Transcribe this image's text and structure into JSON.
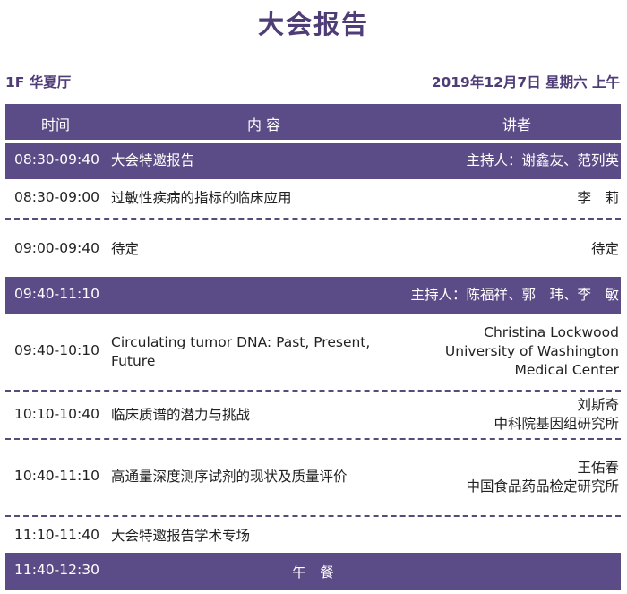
{
  "title": "大会报告",
  "venue": "1F 华夏厅",
  "date": "2019年12月7日 星期六 上午",
  "headers": {
    "time": "时间",
    "content": "内 容",
    "speaker": "讲者"
  },
  "rows": [
    {
      "time": "08:30-09:40",
      "content": "大会特邀报告",
      "speaker": "主持人：谢鑫友、范列英"
    },
    {
      "time": "08:30-09:00",
      "content": "过敏性疾病的指标的临床应用",
      "speaker": "李　莉"
    },
    {
      "time": "09:00-09:40",
      "content": "待定",
      "speaker": "待定"
    },
    {
      "time": "09:40-11:10",
      "content": "",
      "speaker": "主持人：陈福祥、郭　玮、李　敏"
    },
    {
      "time": "09:40-10:10",
      "content_lines": [
        "Circulating tumor DNA: Past, Present,",
        "Future"
      ],
      "speaker_lines": [
        "Christina Lockwood",
        "University of Washington",
        "Medical Center"
      ]
    },
    {
      "time": "10:10-10:40",
      "content": "临床质谱的潜力与挑战",
      "speaker_lines": [
        "刘斯奇",
        "中科院基因组研究所"
      ]
    },
    {
      "time": "10:40-11:10",
      "content": "高通量深度测序试剂的现状及质量评价",
      "speaker_lines": [
        "王佑春",
        "中国食品药品检定研究所"
      ]
    },
    {
      "time": "11:10-11:40",
      "content": "大会特邀报告学术专场",
      "speaker": ""
    },
    {
      "time": "11:40-12:30",
      "content": "午　餐",
      "speaker": ""
    }
  ],
  "colors": {
    "accent": "#5b4b86",
    "title": "#4f3d78"
  }
}
